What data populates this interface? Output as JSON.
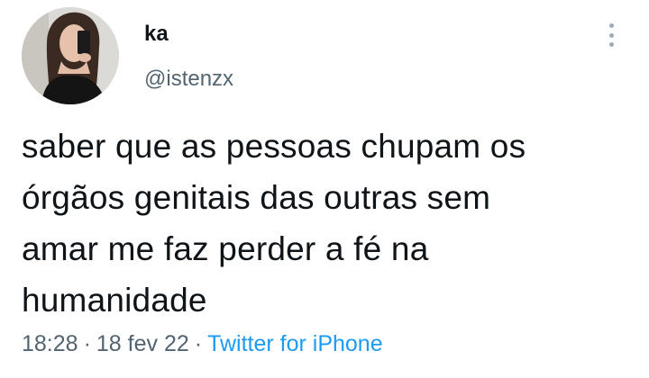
{
  "user": {
    "display_name": "ka",
    "handle": "@istenzx",
    "avatar_icon": "profile-photo"
  },
  "tweet": {
    "text_lines": [
      "saber que as pessoas chupam os",
      "órgãos genitais das outras sem",
      "amar me faz perder a fé na",
      "humanidade"
    ],
    "time": "18:28",
    "date": "18 fev 22",
    "source": "Twitter for iPhone",
    "separator": "·"
  },
  "menu": {
    "icon": "more-vertical-icon"
  },
  "colors": {
    "text": "#0f1419",
    "secondary": "#536471",
    "link": "#1d9bf0",
    "background": "#ffffff"
  }
}
